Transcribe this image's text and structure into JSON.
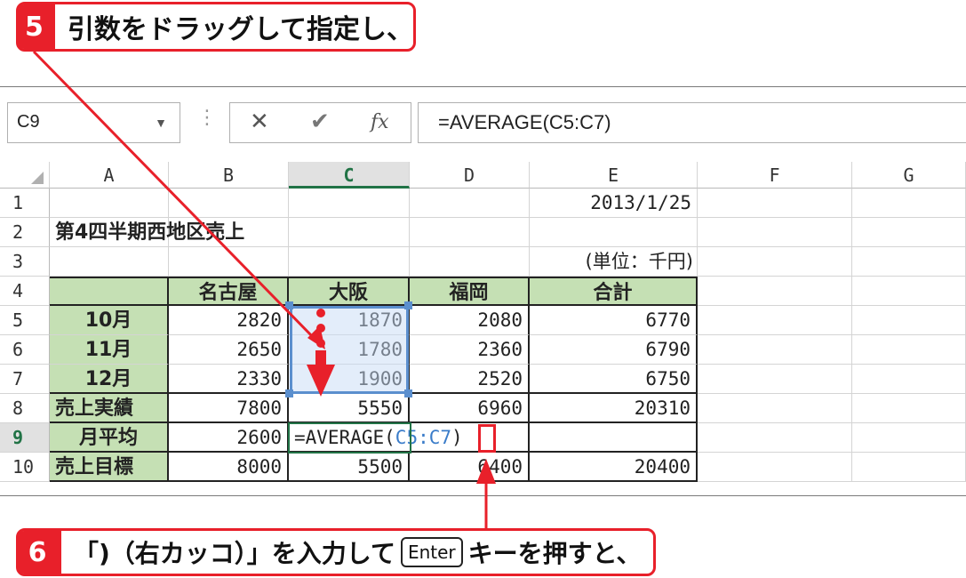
{
  "callouts": {
    "step5": {
      "num": "5",
      "text": "引数をドラッグして指定し、"
    },
    "step6": {
      "num": "6",
      "text_before": "「)（右カッコ）」を入力して",
      "key": "Enter",
      "text_after": "キーを押すと、"
    }
  },
  "formula_bar": {
    "name_box": "C9",
    "formula": "=AVERAGE(C5:C7)",
    "cancel_icon": "✕",
    "enter_icon": "✔",
    "fx_icon": "fx"
  },
  "columns": [
    "A",
    "B",
    "C",
    "D",
    "E",
    "F",
    "G"
  ],
  "rows": [
    "1",
    "2",
    "3",
    "4",
    "5",
    "6",
    "7",
    "8",
    "9",
    "10"
  ],
  "cells": {
    "e1": "2013/1/25",
    "a2": "第4四半期西地区売上",
    "e3": "(単位：千円)",
    "header": [
      "",
      "名古屋",
      "大阪",
      "福岡",
      "合計"
    ],
    "r5": [
      "10月",
      "2820",
      "1870",
      "2080",
      "6770"
    ],
    "r6": [
      "11月",
      "2650",
      "1780",
      "2360",
      "6790"
    ],
    "r7": [
      "12月",
      "2330",
      "1900",
      "2520",
      "6750"
    ],
    "r8": [
      "売上実績",
      "7800",
      "5550",
      "6960",
      "20310"
    ],
    "r9": [
      "月平均",
      "2600",
      "",
      "",
      ""
    ],
    "r10": [
      "売上目標",
      "8000",
      "5500",
      "6400",
      "20400"
    ]
  },
  "edit": {
    "prefix": "=AVERAGE(",
    "ref": "C5:C7",
    "suffix": ")"
  },
  "colors": {
    "accent_red": "#e8202a",
    "header_green": "#c5e0b4",
    "excel_green": "#217346",
    "ref_blue": "#3a7cc9"
  }
}
